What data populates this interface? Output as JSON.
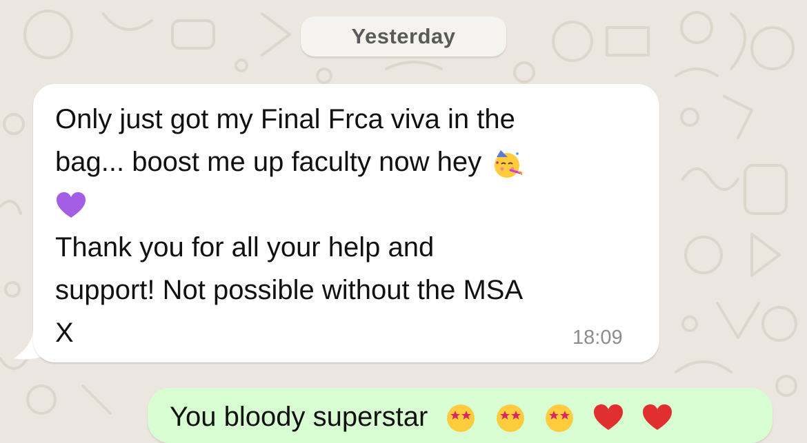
{
  "date_separator": "Yesterday",
  "incoming_message": {
    "lines": [
      "Only just got my Final Frca viva in the",
      "bag... boost me up faculty now hey",
      "",
      "Thank you for all your help and",
      "support! Not possible without the MSA",
      "X"
    ],
    "inline_icons": [
      "partying-face-emoji",
      "purple-heart-emoji"
    ],
    "time": "18:09"
  },
  "outgoing_message": {
    "text": "You bloody superstar",
    "trailing_icons": [
      "star-struck-emoji",
      "star-struck-emoji",
      "star-struck-emoji",
      "red-heart-emoji",
      "red-heart-emoji"
    ]
  },
  "colors": {
    "wallpaper": "#ebe6df",
    "incoming_bubble": "#ffffff",
    "outgoing_bubble": "#d9fdd3",
    "timestamp": "#8c8c8c"
  }
}
